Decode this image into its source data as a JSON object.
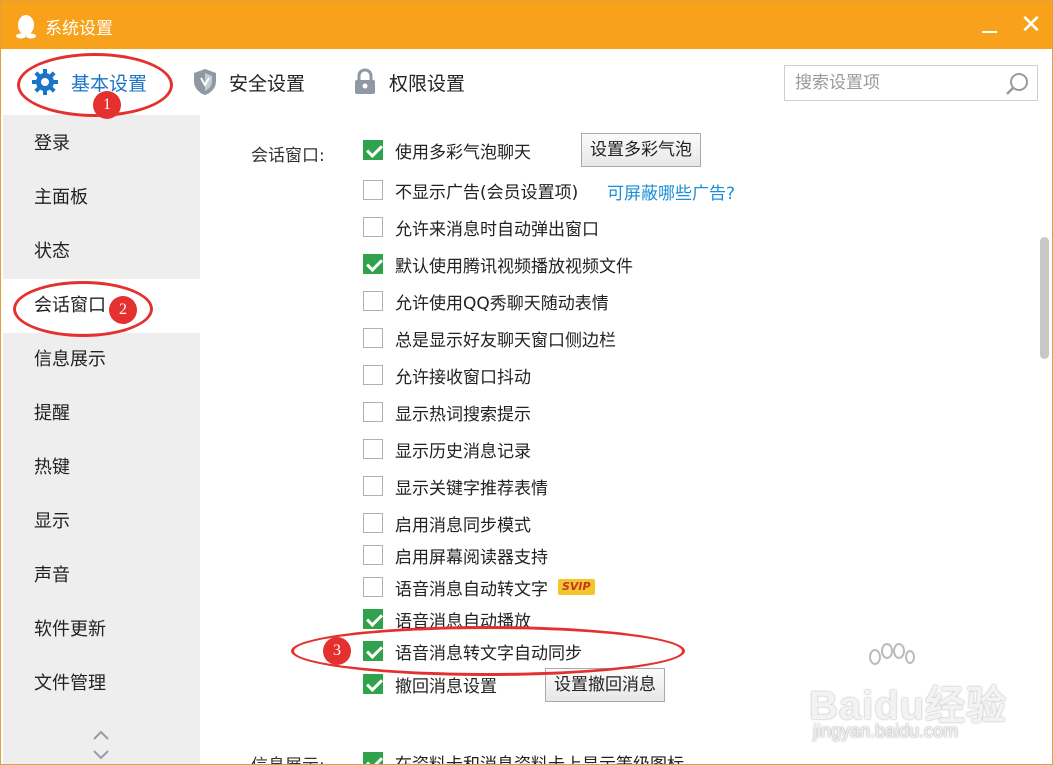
{
  "window": {
    "title": "系统设置"
  },
  "toolbar": {
    "tabs": [
      {
        "label": "基本设置"
      },
      {
        "label": "安全设置"
      },
      {
        "label": "权限设置"
      }
    ],
    "search_placeholder": "搜索设置项"
  },
  "sidebar": {
    "items": [
      {
        "label": "登录"
      },
      {
        "label": "主面板"
      },
      {
        "label": "状态"
      },
      {
        "label": "会话窗口"
      },
      {
        "label": "信息展示"
      },
      {
        "label": "提醒"
      },
      {
        "label": "热键"
      },
      {
        "label": "显示"
      },
      {
        "label": "声音"
      },
      {
        "label": "软件更新"
      },
      {
        "label": "文件管理"
      }
    ],
    "active": "会话窗口"
  },
  "content": {
    "section_label": "会话窗口:",
    "next_section_label": "信息展示:",
    "options": [
      {
        "label": "使用多彩气泡聊天",
        "checked": true
      },
      {
        "label": "不显示广告(会员设置项)",
        "checked": false
      },
      {
        "label": "允许来消息时自动弹出窗口",
        "checked": false
      },
      {
        "label": "默认使用腾讯视频播放视频文件",
        "checked": true
      },
      {
        "label": "允许使用QQ秀聊天随动表情",
        "checked": false
      },
      {
        "label": "总是显示好友聊天窗口侧边栏",
        "checked": false
      },
      {
        "label": "允许接收窗口抖动",
        "checked": false
      },
      {
        "label": "显示热词搜索提示",
        "checked": false
      },
      {
        "label": "显示历史消息记录",
        "checked": false
      },
      {
        "label": "显示关键字推荐表情",
        "checked": false
      },
      {
        "label": "启用消息同步模式",
        "checked": false
      },
      {
        "label": "启用屏幕阅读器支持",
        "checked": false
      },
      {
        "label": "语音消息自动转文字",
        "checked": false,
        "badge": "SVIP"
      },
      {
        "label": "语音消息自动播放",
        "checked": true
      },
      {
        "label": "语音消息转文字自动同步",
        "checked": true
      },
      {
        "label": "撤回消息设置",
        "checked": true
      }
    ],
    "next_option": {
      "label": "在资料卡和消息资料卡上显示等级图标",
      "checked": true
    },
    "bubble_button": "设置多彩气泡",
    "ad_link": "可屏蔽哪些广告?",
    "recall_button": "设置撤回消息"
  },
  "annotations": {
    "n1": "1",
    "n2": "2",
    "n3": "3"
  },
  "watermark": {
    "logo": "Baidu经验",
    "url": "jingyan.baidu.com"
  },
  "colors": {
    "titlebar": "#f7a21a",
    "accent": "#1a74c8",
    "check": "#31a24c",
    "annotation": "#e4312f",
    "link": "#1a8fd8"
  },
  "icons": {
    "title": "qq-penguin-icon",
    "basic": "gear-icon",
    "security": "shield-icon",
    "perm": "lock-icon",
    "search": "search-icon"
  }
}
